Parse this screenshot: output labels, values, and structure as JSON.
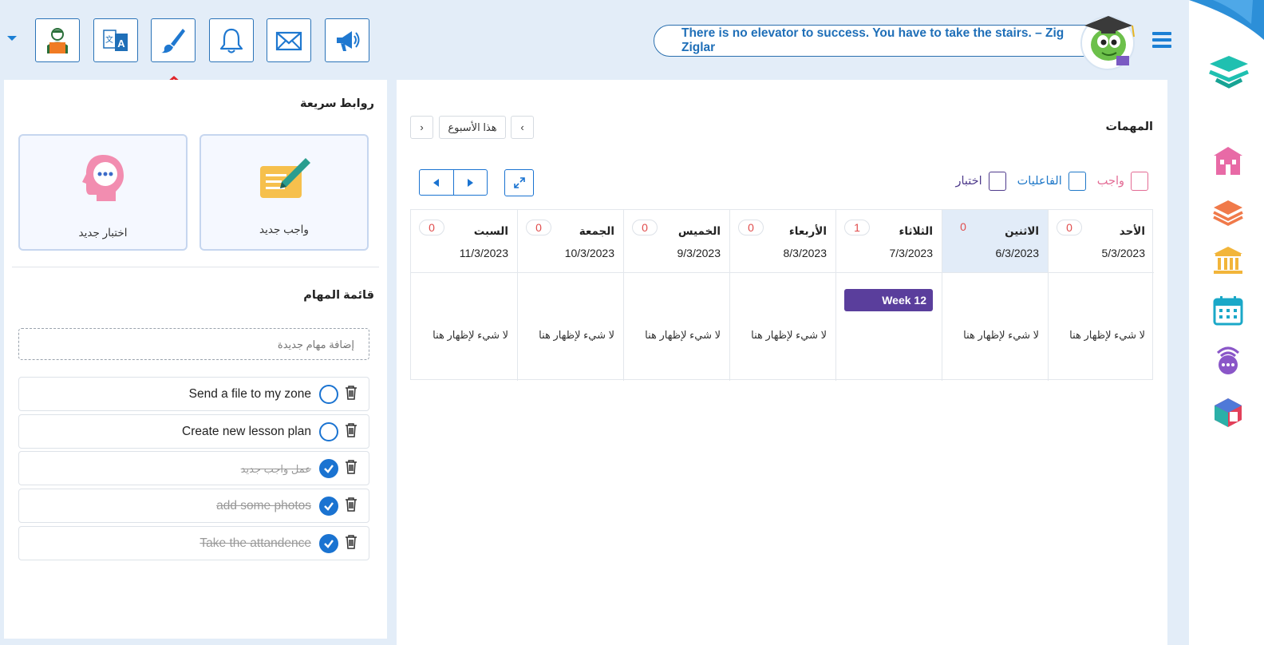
{
  "topbar": {
    "quote": "There is no elevator to success. You have to take the stairs. – Zig Ziglar",
    "tools": [
      {
        "name": "profile-teacher-icon"
      },
      {
        "name": "translate-icon"
      },
      {
        "name": "paint-brush-icon"
      },
      {
        "name": "bell-icon"
      },
      {
        "name": "mail-icon"
      },
      {
        "name": "megaphone-icon"
      }
    ]
  },
  "colors": {
    "accent": "#1a73d1",
    "event": "#5a3e9c",
    "count_red": "#e04c4c",
    "homework_pink": "#e36b94",
    "activities_blue": "#1f78c8",
    "quiz_purple": "#4f3b8c"
  },
  "quick_links": {
    "title": "روابط سريعة",
    "cards": [
      {
        "label": "واجب جديد",
        "icon": "homework-pen-icon"
      },
      {
        "label": "اختبار جديد",
        "icon": "quiz-head-icon"
      }
    ]
  },
  "todo": {
    "title": "قائمة المهام",
    "placeholder": "إضافة مهام جديدة",
    "items": [
      {
        "text": "Send a file to my zone",
        "done": false
      },
      {
        "text": "Create new lesson plan",
        "done": false
      },
      {
        "text": "عمل واجب جديد",
        "done": true
      },
      {
        "text": "add some photos",
        "done": true
      },
      {
        "text": "Take the attandence",
        "done": true
      }
    ]
  },
  "tasks": {
    "title": "المهمات",
    "week_label": "هذا الأسبوع",
    "prev": "‹",
    "next": "›",
    "filters": [
      {
        "label": "واجب"
      },
      {
        "label": "الفاعليات"
      },
      {
        "label": "اختبار"
      }
    ],
    "days": [
      {
        "name": "الأحد",
        "date": "5/3/2023",
        "count": "0",
        "empty": "لا شيء لإظهار هنا"
      },
      {
        "name": "الاثنين",
        "date": "6/3/2023",
        "count": "0",
        "empty": "لا شيء لإظهار هنا"
      },
      {
        "name": "الثلاثاء",
        "date": "7/3/2023",
        "count": "1",
        "event": "Week 12"
      },
      {
        "name": "الأربعاء",
        "date": "8/3/2023",
        "count": "0",
        "empty": "لا شيء لإظهار هنا"
      },
      {
        "name": "الخميس",
        "date": "9/3/2023",
        "count": "0",
        "empty": "لا شيء لإظهار هنا"
      },
      {
        "name": "الجمعة",
        "date": "10/3/2023",
        "count": "0",
        "empty": "لا شيء لإظهار هنا"
      },
      {
        "name": "السبت",
        "date": "11/3/2023",
        "count": "0",
        "empty": "لا شيء لإظهار هنا"
      }
    ]
  }
}
